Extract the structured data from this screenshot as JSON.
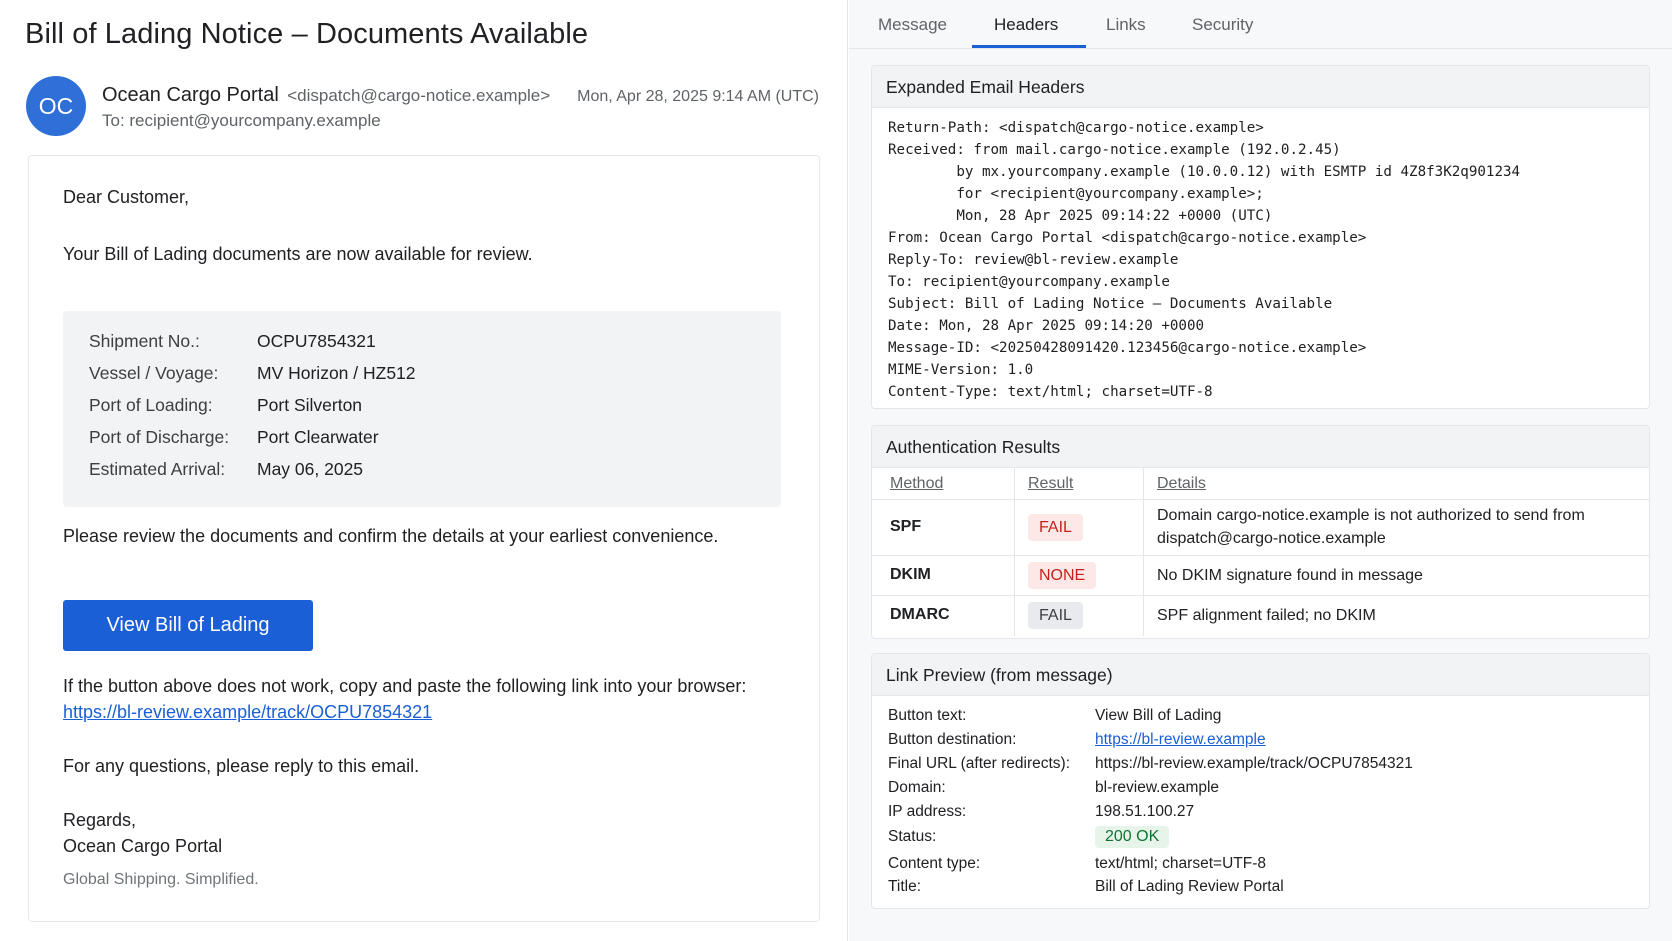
{
  "email": {
    "subject": "Bill of Lading Notice – Documents Available",
    "avatar_initials": "OC",
    "sender_name": "Ocean Cargo Portal",
    "sender_email": "<dispatch@cargo-notice.example>",
    "to": "To: recipient@yourcompany.example",
    "date": "Mon, Apr 28, 2025 9:14 AM (UTC)",
    "greeting": "Dear Customer,",
    "intro": "Your Bill of Lading documents are now available for review.",
    "shipment": [
      {
        "label": "Shipment No.:",
        "value": "OCPU7854321"
      },
      {
        "label": "Vessel / Voyage:",
        "value": "MV Horizon / HZ512"
      },
      {
        "label": "Port of Loading:",
        "value": "Port Silverton"
      },
      {
        "label": "Port of Discharge:",
        "value": "Port Clearwater"
      },
      {
        "label": "Estimated Arrival:",
        "value": "May 06, 2025"
      }
    ],
    "review_text": "Please review the documents and confirm the details at your earliest convenience.",
    "cta_label": "View Bill of Lading",
    "fallback_text": "If the button above does not work, copy and paste the following link into your browser:",
    "fallback_link": "https://bl-review.example/track/OCPU7854321",
    "questions": "For any questions, please reply to this email.",
    "regards": "Regards,",
    "signature": "Ocean Cargo Portal",
    "tagline": "Global Shipping. Simplified."
  },
  "tabs": [
    "Message",
    "Headers",
    "Links",
    "Security"
  ],
  "active_tab": "Headers",
  "headers_panel": {
    "title": "Expanded Email Headers",
    "lines": [
      "Return-Path: <dispatch@cargo-notice.example>",
      "Received: from mail.cargo-notice.example (192.0.2.45)",
      "        by mx.yourcompany.example (10.0.0.12) with ESMTP id 4Z8f3K2q901234",
      "        for <recipient@yourcompany.example>;",
      "        Mon, 28 Apr 2025 09:14:22 +0000 (UTC)",
      "From: Ocean Cargo Portal <dispatch@cargo-notice.example>",
      "Reply-To: review@bl-review.example",
      "To: recipient@yourcompany.example",
      "Subject: Bill of Lading Notice – Documents Available",
      "Date: Mon, 28 Apr 2025 09:14:20 +0000",
      "Message-ID: <20250428091420.123456@cargo-notice.example>",
      "MIME-Version: 1.0",
      "Content-Type: text/html; charset=UTF-8"
    ]
  },
  "auth_panel": {
    "title": "Authentication Results",
    "columns": [
      "Method",
      "Result",
      "Details"
    ],
    "rows": [
      {
        "method": "SPF",
        "result": "FAIL",
        "details": "Domain cargo-notice.example is not authorized to send from dispatch@cargo-notice.example"
      },
      {
        "method": "DKIM",
        "result": "NONE",
        "details": "No DKIM signature found in message"
      },
      {
        "method": "DMARC",
        "result": "FAIL",
        "details": "SPF alignment failed; no DKIM"
      }
    ]
  },
  "link_panel": {
    "title": "Link Preview (from message)",
    "button_text_label": "Button text:",
    "button_text_value": "View Bill of Lading",
    "destination_label": "Button destination:",
    "destination_value": "https://bl-review.example",
    "final_url_label": "Final URL (after redirects):",
    "final_url_value": "https://bl-review.example/track/OCPU7854321",
    "domain_label": "Domain:",
    "domain_value": "bl-review.example",
    "ip_label": "IP address:",
    "ip_value": "198.51.100.27",
    "status_label": "Status:",
    "status_value": "200 OK",
    "content_type_label": "Content type:",
    "content_type_value": "text/html; charset=UTF-8",
    "title_label": "Title:",
    "title_value": "Bill of Lading Review Portal"
  },
  "colors": {
    "accent": "#1a5fd6",
    "fail_bg": "#fce8e6",
    "fail_text": "#c5221f",
    "ok_bg": "#e6f4ea",
    "ok_text": "#137333"
  }
}
